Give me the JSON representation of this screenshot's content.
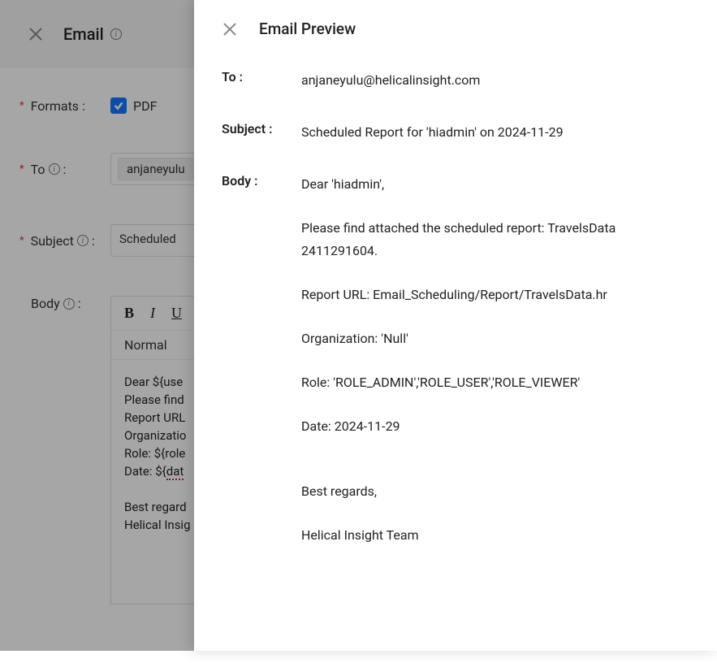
{
  "email_panel": {
    "title": "Email",
    "formats_label": "Formats :",
    "format_pdf_label": "PDF",
    "to_label": "To",
    "to_value": "anjaneyulu",
    "subject_label": "Subject",
    "subject_value": "Scheduled",
    "body_label": "Body",
    "toolbar_normal": "Normal",
    "body_lines": {
      "l0": "Dear ${use",
      "l1": "Please find",
      "l2": "Report URL",
      "l3": "Organizatio",
      "l4": "Role: ${role",
      "l5a": "Date: ${",
      "l5b": "dat",
      "l6": "Best regard",
      "l7": "Helical Insig"
    }
  },
  "preview": {
    "title": "Email Preview",
    "to_label": "To :",
    "to_value": "anjaneyulu@helicalinsight.com",
    "subject_label": "Subject :",
    "subject_value": "Scheduled Report for 'hiadmin' on 2024-11-29",
    "body_label": "Body :",
    "body": {
      "p0": "Dear 'hiadmin',",
      "p1": "Please find attached the scheduled report: TravelsData 2411291604.",
      "p2": "Report URL: Email_Scheduling/Report/TravelsData.hr",
      "p3": "Organization: 'Null'",
      "p4": "Role: 'ROLE_ADMIN','ROLE_USER','ROLE_VIEWER'",
      "p5": "Date: 2024-11-29",
      "p6": "Best regards,",
      "p7": "Helical Insight Team"
    }
  }
}
